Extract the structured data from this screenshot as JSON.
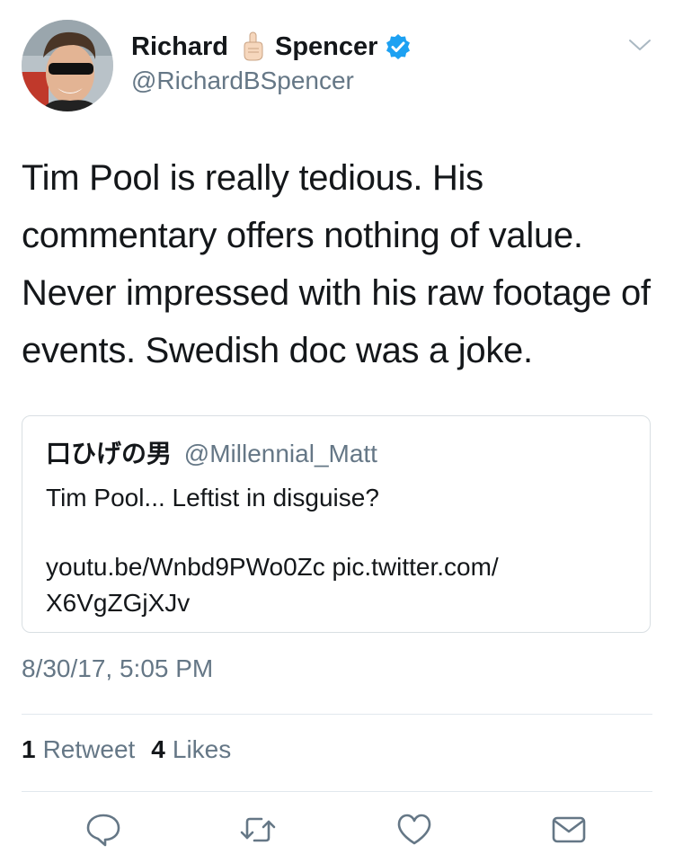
{
  "tweet": {
    "author_name_first": "Richard",
    "author_name_last": "Spencer",
    "author_handle": "@RichardBSpencer",
    "text": "Tim Pool is really tedious. His commentary offers nothing of value. Never impressed with his raw footage of events. Swedish doc was a joke.",
    "timestamp": "8/30/17, 5:05 PM"
  },
  "quote": {
    "author_name": "口ひげの男",
    "author_handle": "@Millennial_Matt",
    "text": "Tim Pool... Leftist in disguise?",
    "link_line_1": "youtu.be/Wnbd9PWo0Zc pic.twitter.com/",
    "link_line_2": "X6VgZGjXJv"
  },
  "stats": {
    "retweet_count": "1",
    "retweet_label": "Retweet",
    "like_count": "4",
    "like_label": "Likes"
  },
  "icons": {
    "reply": "reply-icon",
    "retweet": "retweet-icon",
    "like": "heart-icon",
    "message": "envelope-icon",
    "verified": "verified-badge-icon",
    "menu": "chevron-down-icon",
    "emoji": "index-pointing-up-emoji"
  },
  "colors": {
    "verified": "#1da1f2",
    "secondary_text": "#657786",
    "icon_gray": "#657786",
    "border": "#e1e8ed"
  }
}
